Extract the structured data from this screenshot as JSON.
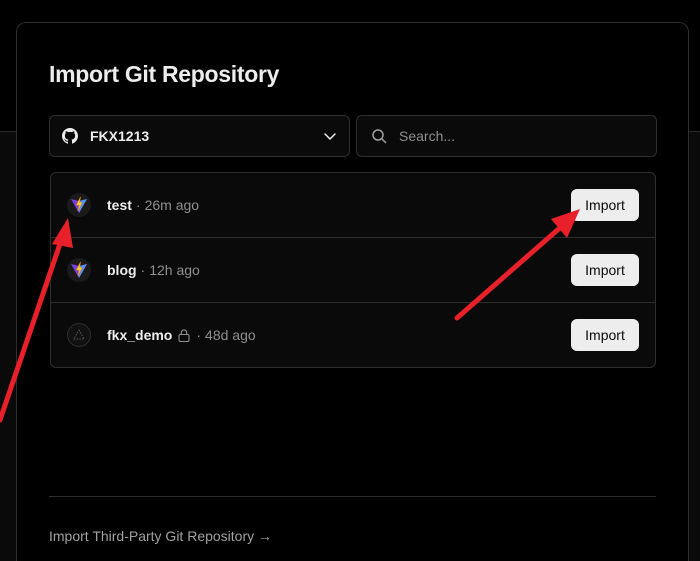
{
  "modal": {
    "title": "Import Git Repository"
  },
  "account_select": {
    "value": "FKX1213",
    "icon": "github-icon"
  },
  "search": {
    "placeholder": "Search..."
  },
  "repos": [
    {
      "name": "test",
      "age": "26m ago",
      "private": false,
      "icon": "vite-icon",
      "button": "Import"
    },
    {
      "name": "blog",
      "age": "12h ago",
      "private": false,
      "icon": "vite-icon",
      "button": "Import"
    },
    {
      "name": "fkx_demo",
      "age": "48d ago",
      "private": true,
      "icon": "vercel-icon",
      "button": "Import"
    }
  ],
  "separator": "·",
  "footer": {
    "link": "Import Third-Party Git Repository →"
  },
  "colors": {
    "background": "#000000",
    "text": "#ededed",
    "muted": "#8f8f8f",
    "border": "#2e2e2e",
    "button_bg": "#ededed",
    "annotation_arrow": "#e8202a"
  }
}
